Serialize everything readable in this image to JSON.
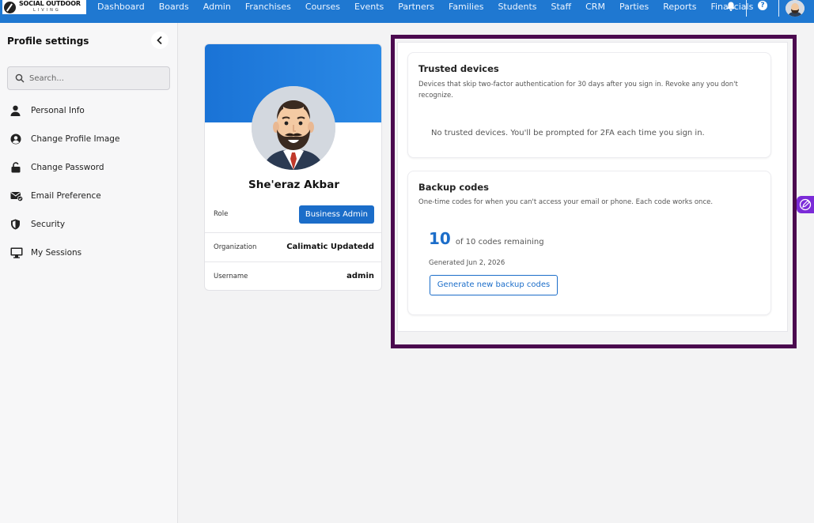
{
  "nav": {
    "brand_line1": "SOCIAL OUTDOOR",
    "brand_line2": "LIVING",
    "items": [
      "Dashboard",
      "Boards",
      "Admin",
      "Franchises",
      "Courses",
      "Events",
      "Partners",
      "Families",
      "Students",
      "Staff",
      "CRM",
      "Parties",
      "Reports",
      "Financials"
    ],
    "help_glyph": "?",
    "icons": [
      "bell-icon",
      "help-icon",
      "user-avatar"
    ]
  },
  "sidebar": {
    "title": "Profile settings",
    "search_placeholder": "Search...",
    "items": [
      {
        "label": "Personal Info",
        "icon": "person-icon"
      },
      {
        "label": "Change Profile Image",
        "icon": "user-circle-icon"
      },
      {
        "label": "Change Password",
        "icon": "unlock-icon"
      },
      {
        "label": "Email Preference",
        "icon": "mail-check-icon"
      },
      {
        "label": "Security",
        "icon": "shield-icon"
      },
      {
        "label": "My Sessions",
        "icon": "monitor-icon"
      }
    ]
  },
  "profile": {
    "name": "She'eraz Akbar",
    "role_label": "Role",
    "role_value": "Business Admin",
    "org_label": "Organization",
    "org_value": "Calimatic Updatedd",
    "username_label": "Username",
    "username_value": "admin"
  },
  "trusted_devices": {
    "title": "Trusted devices",
    "description": "Devices that skip two-factor authentication for 30 days after you sign in. Revoke any you don't recognize.",
    "empty_text": "No trusted devices. You'll be prompted for 2FA each time you sign in."
  },
  "backup_codes": {
    "title": "Backup codes",
    "description": "One-time codes for when you can't access your email or phone. Each code works once.",
    "remaining": "10",
    "remaining_suffix": "of 10 codes remaining",
    "generated": "Generated Jun 2, 2026",
    "button": "Generate new backup codes"
  },
  "colors": {
    "primary": "#1f78d1",
    "button": "#1b6dc9",
    "highlight_frame": "#4b0a4f",
    "side_tab": "#7b2bd8"
  }
}
